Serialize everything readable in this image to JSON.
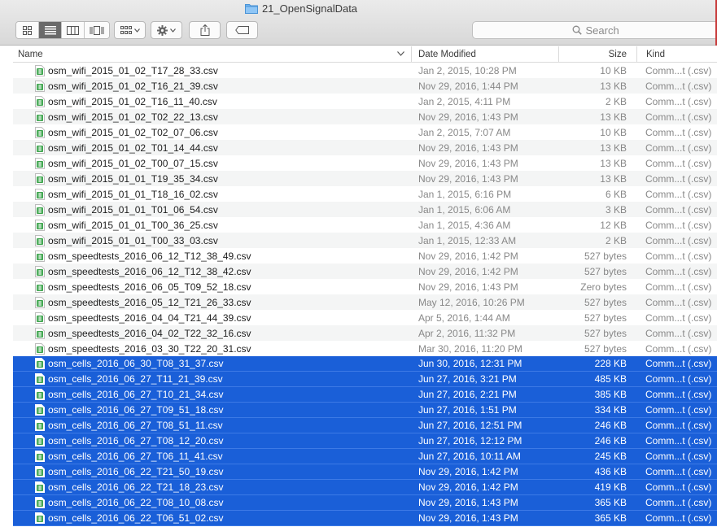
{
  "window": {
    "title": "21_OpenSignalData"
  },
  "toolbar": {
    "view_icon_labels": [
      "icon-view-icon",
      "list-view-icon",
      "column-view-icon",
      "cover-flow-view-icon"
    ],
    "arrange_icon": "arrange-icon",
    "action_icon": "gear-icon",
    "share_icon": "share-icon",
    "tag_icon": "tag-icon"
  },
  "search": {
    "placeholder": "Search"
  },
  "columns": {
    "name": "Name",
    "date": "Date Modified",
    "size": "Size",
    "kind": "Kind"
  },
  "colors": {
    "selection": "#1a5fd8",
    "file_icon": "#3aa34a"
  },
  "files": [
    {
      "name": "osm_wifi_2015_01_02_T17_28_33.csv",
      "date": "Jan 2, 2015, 10:28 PM",
      "size": "10 KB",
      "kind": "Comm...t (.csv)",
      "selected": false
    },
    {
      "name": "osm_wifi_2015_01_02_T16_21_39.csv",
      "date": "Nov 29, 2016, 1:44 PM",
      "size": "13 KB",
      "kind": "Comm...t (.csv)",
      "selected": false
    },
    {
      "name": "osm_wifi_2015_01_02_T16_11_40.csv",
      "date": "Jan 2, 2015, 4:11 PM",
      "size": "2 KB",
      "kind": "Comm...t (.csv)",
      "selected": false
    },
    {
      "name": "osm_wifi_2015_01_02_T02_22_13.csv",
      "date": "Nov 29, 2016, 1:43 PM",
      "size": "13 KB",
      "kind": "Comm...t (.csv)",
      "selected": false
    },
    {
      "name": "osm_wifi_2015_01_02_T02_07_06.csv",
      "date": "Jan 2, 2015, 7:07 AM",
      "size": "10 KB",
      "kind": "Comm...t (.csv)",
      "selected": false
    },
    {
      "name": "osm_wifi_2015_01_02_T01_14_44.csv",
      "date": "Nov 29, 2016, 1:43 PM",
      "size": "13 KB",
      "kind": "Comm...t (.csv)",
      "selected": false
    },
    {
      "name": "osm_wifi_2015_01_02_T00_07_15.csv",
      "date": "Nov 29, 2016, 1:43 PM",
      "size": "13 KB",
      "kind": "Comm...t (.csv)",
      "selected": false
    },
    {
      "name": "osm_wifi_2015_01_01_T19_35_34.csv",
      "date": "Nov 29, 2016, 1:43 PM",
      "size": "13 KB",
      "kind": "Comm...t (.csv)",
      "selected": false
    },
    {
      "name": "osm_wifi_2015_01_01_T18_16_02.csv",
      "date": "Jan 1, 2015, 6:16 PM",
      "size": "6 KB",
      "kind": "Comm...t (.csv)",
      "selected": false
    },
    {
      "name": "osm_wifi_2015_01_01_T01_06_54.csv",
      "date": "Jan 1, 2015, 6:06 AM",
      "size": "3 KB",
      "kind": "Comm...t (.csv)",
      "selected": false
    },
    {
      "name": "osm_wifi_2015_01_01_T00_36_25.csv",
      "date": "Jan 1, 2015, 4:36 AM",
      "size": "12 KB",
      "kind": "Comm...t (.csv)",
      "selected": false
    },
    {
      "name": "osm_wifi_2015_01_01_T00_33_03.csv",
      "date": "Jan 1, 2015, 12:33 AM",
      "size": "2 KB",
      "kind": "Comm...t (.csv)",
      "selected": false
    },
    {
      "name": "osm_speedtests_2016_06_12_T12_38_49.csv",
      "date": "Nov 29, 2016, 1:42 PM",
      "size": "527 bytes",
      "kind": "Comm...t (.csv)",
      "selected": false
    },
    {
      "name": "osm_speedtests_2016_06_12_T12_38_42.csv",
      "date": "Nov 29, 2016, 1:42 PM",
      "size": "527 bytes",
      "kind": "Comm...t (.csv)",
      "selected": false
    },
    {
      "name": "osm_speedtests_2016_06_05_T09_52_18.csv",
      "date": "Nov 29, 2016, 1:43 PM",
      "size": "Zero bytes",
      "kind": "Comm...t (.csv)",
      "selected": false
    },
    {
      "name": "osm_speedtests_2016_05_12_T21_26_33.csv",
      "date": "May 12, 2016, 10:26 PM",
      "size": "527 bytes",
      "kind": "Comm...t (.csv)",
      "selected": false
    },
    {
      "name": "osm_speedtests_2016_04_04_T21_44_39.csv",
      "date": "Apr 5, 2016, 1:44 AM",
      "size": "527 bytes",
      "kind": "Comm...t (.csv)",
      "selected": false
    },
    {
      "name": "osm_speedtests_2016_04_02_T22_32_16.csv",
      "date": "Apr 2, 2016, 11:32 PM",
      "size": "527 bytes",
      "kind": "Comm...t (.csv)",
      "selected": false
    },
    {
      "name": "osm_speedtests_2016_03_30_T22_20_31.csv",
      "date": "Mar 30, 2016, 11:20 PM",
      "size": "527 bytes",
      "kind": "Comm...t (.csv)",
      "selected": false
    },
    {
      "name": "osm_cells_2016_06_30_T08_31_37.csv",
      "date": "Jun 30, 2016, 12:31 PM",
      "size": "228 KB",
      "kind": "Comm...t (.csv)",
      "selected": true
    },
    {
      "name": "osm_cells_2016_06_27_T11_21_39.csv",
      "date": "Jun 27, 2016, 3:21 PM",
      "size": "485 KB",
      "kind": "Comm...t (.csv)",
      "selected": true
    },
    {
      "name": "osm_cells_2016_06_27_T10_21_34.csv",
      "date": "Jun 27, 2016, 2:21 PM",
      "size": "385 KB",
      "kind": "Comm...t (.csv)",
      "selected": true
    },
    {
      "name": "osm_cells_2016_06_27_T09_51_18.csv",
      "date": "Jun 27, 2016, 1:51 PM",
      "size": "334 KB",
      "kind": "Comm...t (.csv)",
      "selected": true
    },
    {
      "name": "osm_cells_2016_06_27_T08_51_11.csv",
      "date": "Jun 27, 2016, 12:51 PM",
      "size": "246 KB",
      "kind": "Comm...t (.csv)",
      "selected": true
    },
    {
      "name": "osm_cells_2016_06_27_T08_12_20.csv",
      "date": "Jun 27, 2016, 12:12 PM",
      "size": "246 KB",
      "kind": "Comm...t (.csv)",
      "selected": true
    },
    {
      "name": "osm_cells_2016_06_27_T06_11_41.csv",
      "date": "Jun 27, 2016, 10:11 AM",
      "size": "245 KB",
      "kind": "Comm...t (.csv)",
      "selected": true
    },
    {
      "name": "osm_cells_2016_06_22_T21_50_19.csv",
      "date": "Nov 29, 2016, 1:42 PM",
      "size": "436 KB",
      "kind": "Comm...t (.csv)",
      "selected": true
    },
    {
      "name": "osm_cells_2016_06_22_T21_18_23.csv",
      "date": "Nov 29, 2016, 1:42 PM",
      "size": "419 KB",
      "kind": "Comm...t (.csv)",
      "selected": true
    },
    {
      "name": "osm_cells_2016_06_22_T08_10_08.csv",
      "date": "Nov 29, 2016, 1:43 PM",
      "size": "365 KB",
      "kind": "Comm...t (.csv)",
      "selected": true
    },
    {
      "name": "osm_cells_2016_06_22_T06_51_02.csv",
      "date": "Nov 29, 2016, 1:43 PM",
      "size": "365 KB",
      "kind": "Comm...t (.csv)",
      "selected": true
    }
  ]
}
